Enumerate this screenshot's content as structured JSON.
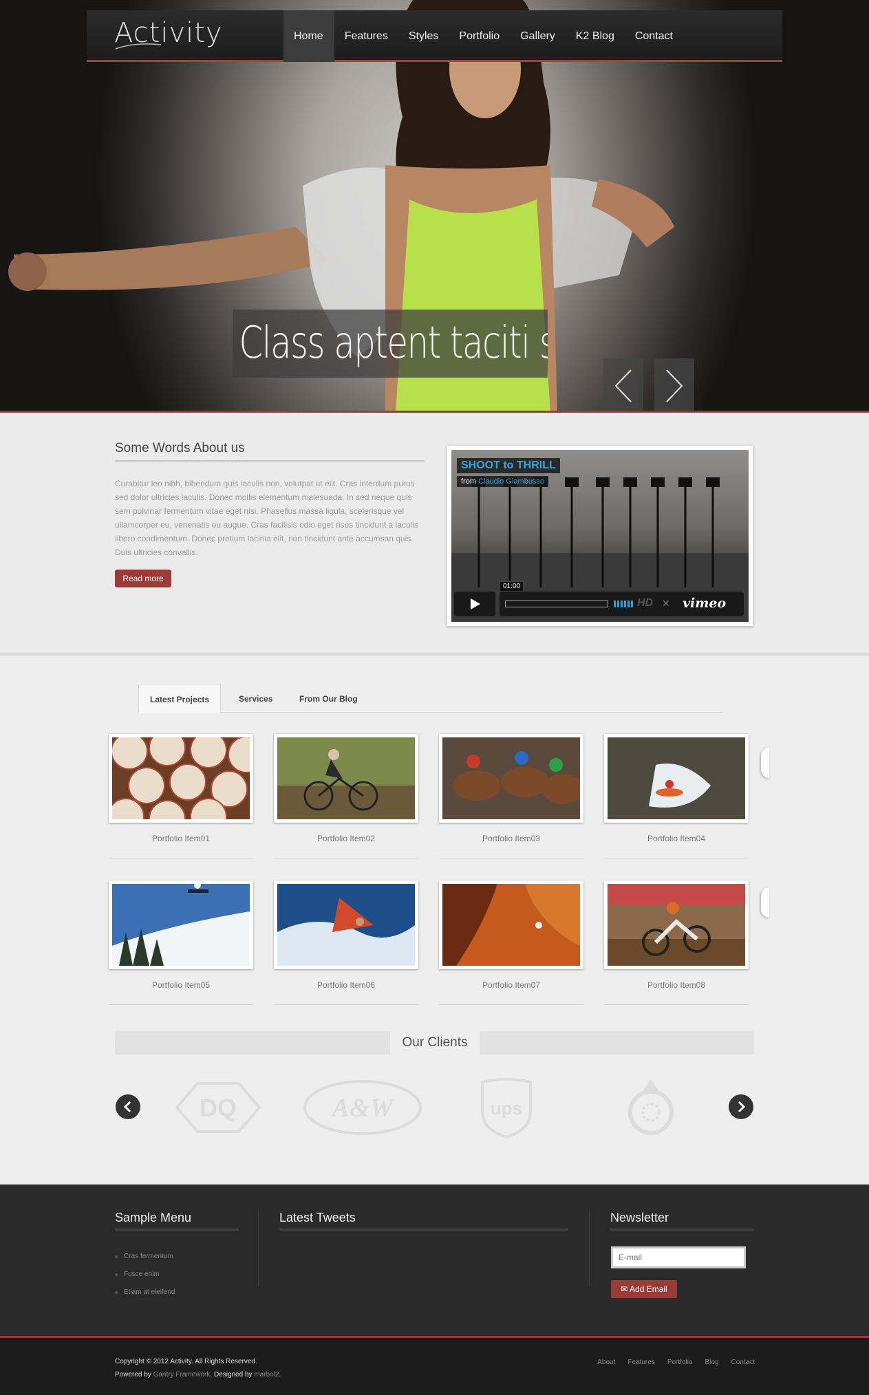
{
  "brand": {
    "logo_text": "Activity"
  },
  "nav": {
    "items": [
      {
        "label": "Home"
      },
      {
        "label": "Features"
      },
      {
        "label": "Styles"
      },
      {
        "label": "Portfolio"
      },
      {
        "label": "Gallery"
      },
      {
        "label": "K2 Blog"
      },
      {
        "label": "Contact"
      }
    ],
    "active": "Home"
  },
  "hero": {
    "caption": "Class aptent taciti sociosqu",
    "prev_icon": "chevron-left-icon",
    "next_icon": "chevron-right-icon"
  },
  "about": {
    "title": "Some Words About us",
    "text": "Curabitur leo nibh, bibendum quis iaculis non, volutpat ut elit. Cras interdum purus sed dolor ultricies iaculis. Donec mollis elementum malesuada. In sed neque quis sem pulvinar fermentum vitae eget nisi. Phasellus massa ligula, scelerisque vel ullamcorper eu, venenatis eu augue. Cras facilisis odio eget risus tincidunt a iaculis libero condimentum. Donec pretium lacinia elit, non tincidunt ante accumsan quis. Duis ultricies convallis.",
    "button": "Read more"
  },
  "video": {
    "title": "SHOOT to THRILL",
    "from_label": "from",
    "author": "Claudio Giambusso",
    "time": "01:00",
    "hd_label": "HD",
    "brand": "vimeo"
  },
  "tabs": [
    {
      "label": "Latest Projects",
      "active": true
    },
    {
      "label": "Services",
      "active": false
    },
    {
      "label": "From Our Blog",
      "active": false
    }
  ],
  "portfolio": [
    {
      "label": "Portfolio Item01"
    },
    {
      "label": "Portfolio Item02"
    },
    {
      "label": "Portfolio Item03"
    },
    {
      "label": "Portfolio Item04"
    },
    {
      "label": "Portfolio Item05"
    },
    {
      "label": "Portfolio Item06"
    },
    {
      "label": "Portfolio Item07"
    },
    {
      "label": "Portfolio Item08"
    }
  ],
  "clients": {
    "title": "Our Clients",
    "logos": [
      {
        "name": "DQ"
      },
      {
        "name": "A&W"
      },
      {
        "name": "ups"
      },
      {
        "name": "recycle-logo"
      }
    ]
  },
  "footer": {
    "menu_title": "Sample Menu",
    "menu_items": [
      "Cras fermentum",
      "Fusce enim",
      "Etiam at eleifend"
    ],
    "tweets_title": "Latest Tweets",
    "newsletter_title": "Newsletter",
    "email_placeholder": "E-mail",
    "add_email": "Add Email"
  },
  "bottom": {
    "copyright": "Copyright © 2012 Activity. All Rights Reserved.",
    "powered_prefix": "Powered by",
    "framework": "Gantry Framework",
    "designed_prefix": ". Designed by",
    "designer": "marbol2",
    "nav": [
      "About",
      "Features",
      "Portfolio",
      "Blog",
      "Contact"
    ]
  },
  "colors": {
    "accent": "#9b3a36",
    "nav_bg": "#222222",
    "footer_bg": "#2a2a2a",
    "video_title": "#33a6e0"
  }
}
